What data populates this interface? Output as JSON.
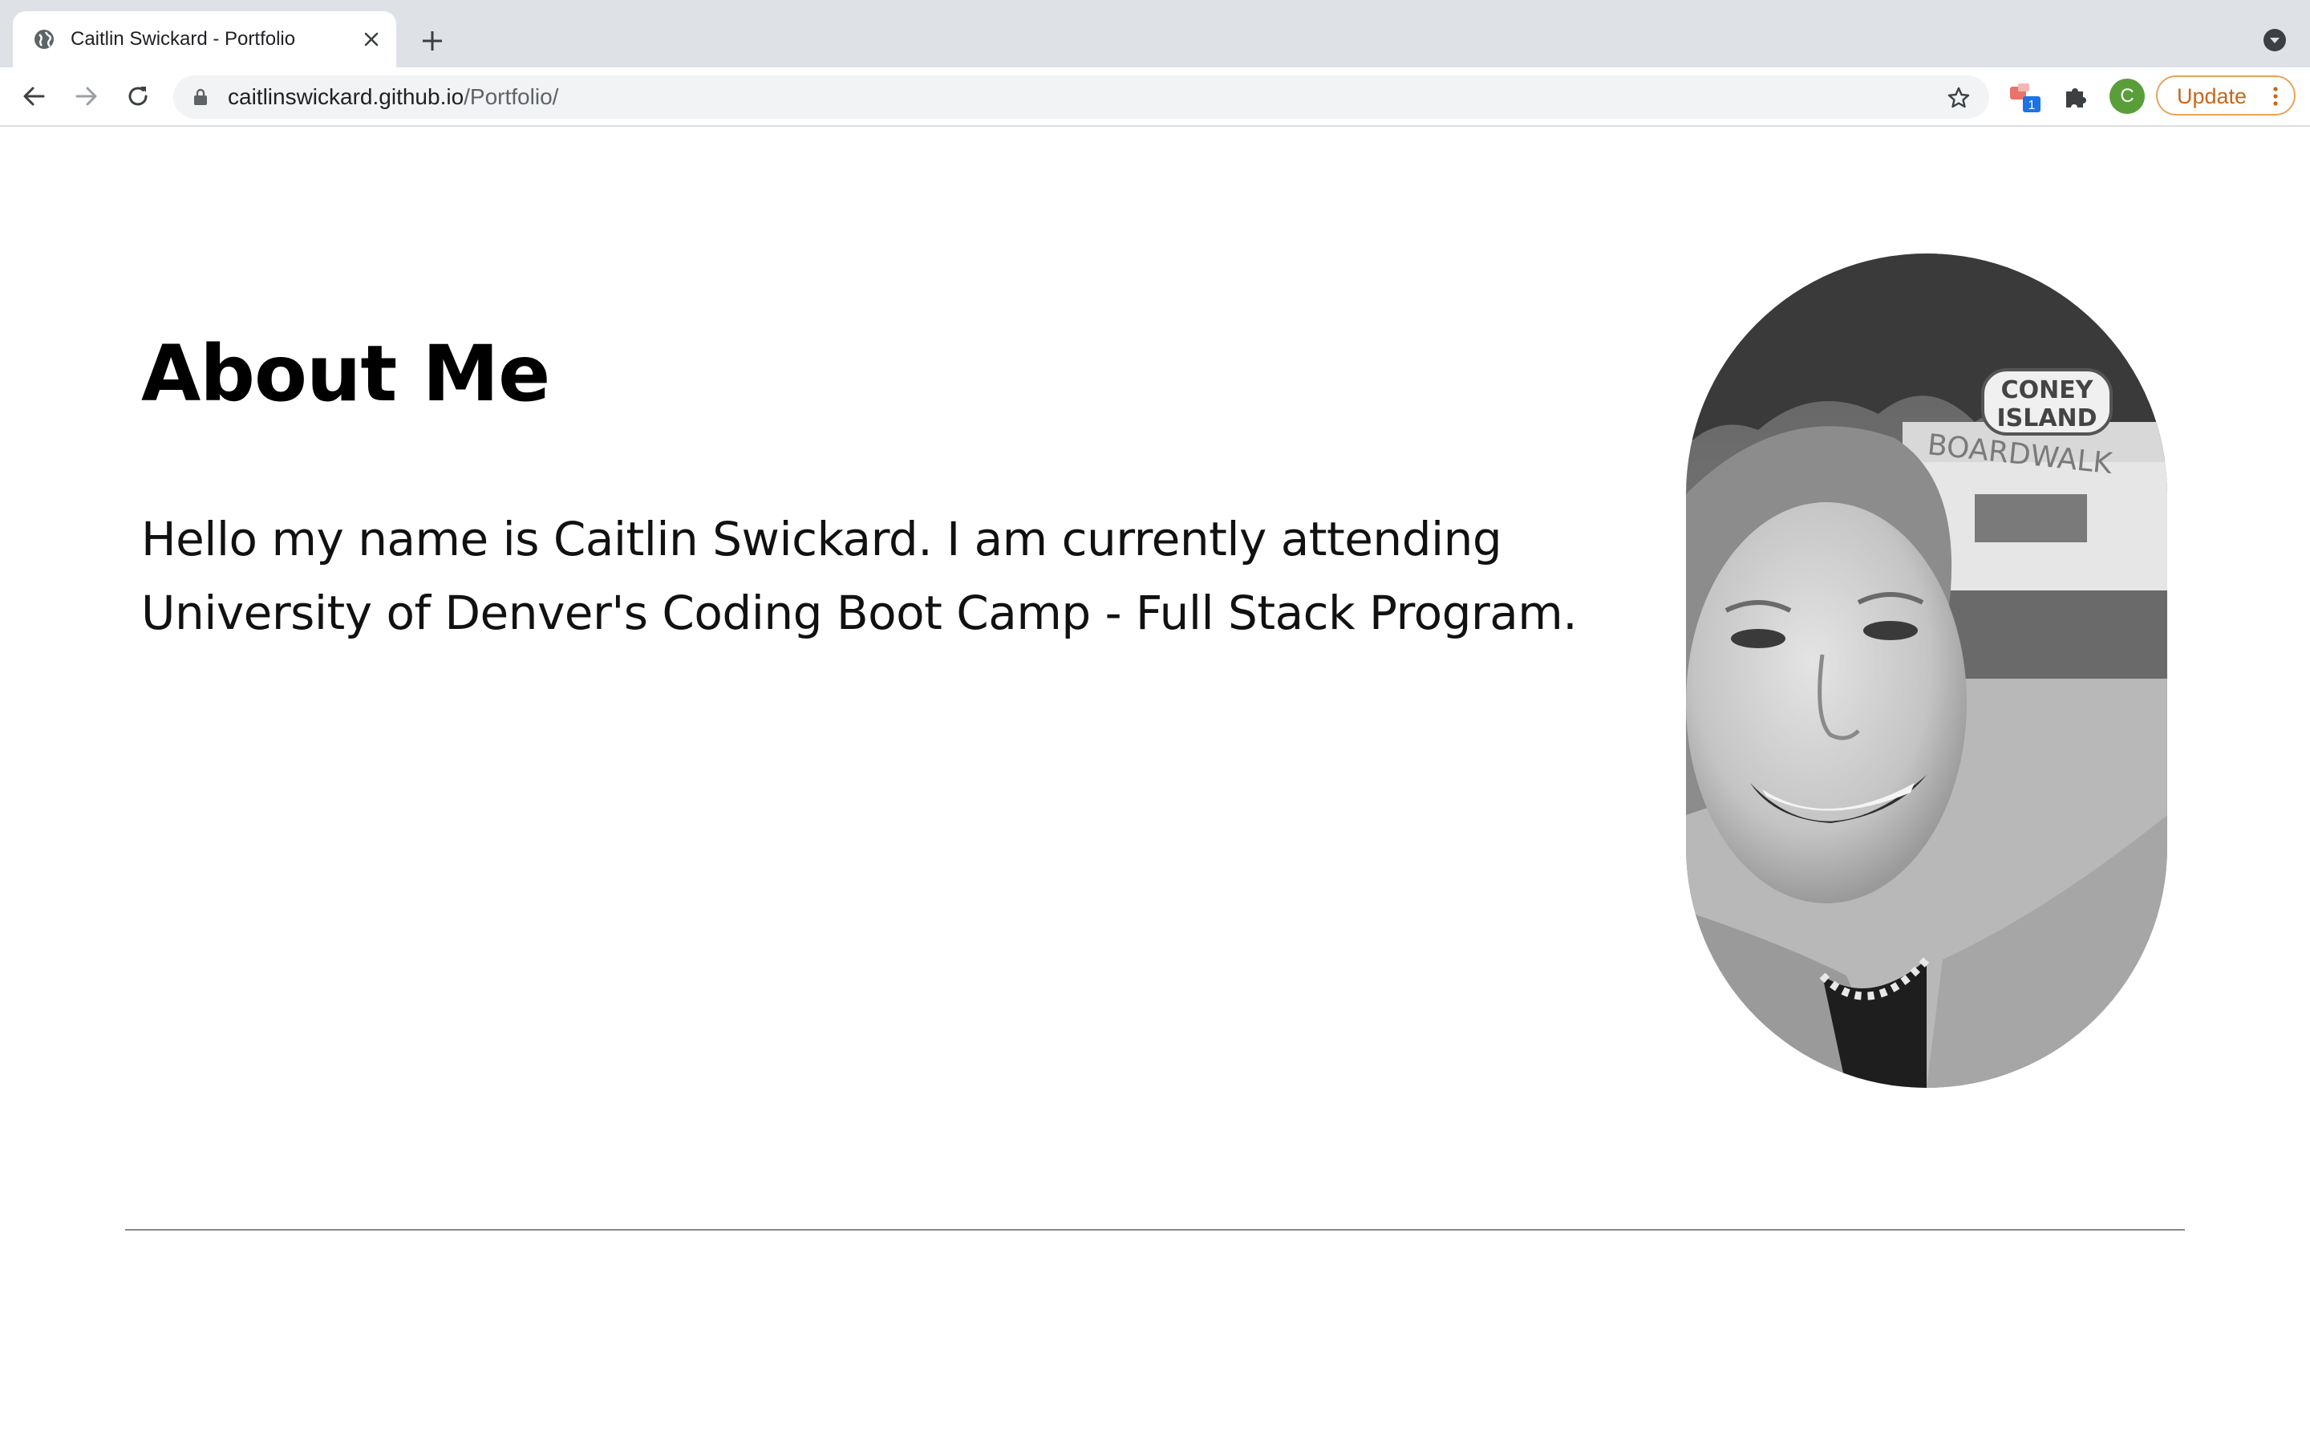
{
  "browser": {
    "tab_title": "Caitlin Swickard - Portfolio",
    "url_host": "caitlinswickard.github.io",
    "url_path": "/Portfolio/",
    "profile_initial": "C",
    "update_label": "Update",
    "extension_badge": "1"
  },
  "page": {
    "heading": "About Me",
    "bio": "Hello my name is Caitlin Swickard. I am currently attending University of Denver's Coding Boot Camp - Full Stack Program.",
    "photo_sign_text": [
      "CONEY",
      "ISLAND",
      "BOARDWALK"
    ]
  },
  "colors": {
    "tabstrip": "#dee1e6",
    "omnibox": "#f1f3f4",
    "avatar": "#5a9e3a",
    "update_accent": "#c5681a",
    "divider": "#8a8a8a"
  }
}
